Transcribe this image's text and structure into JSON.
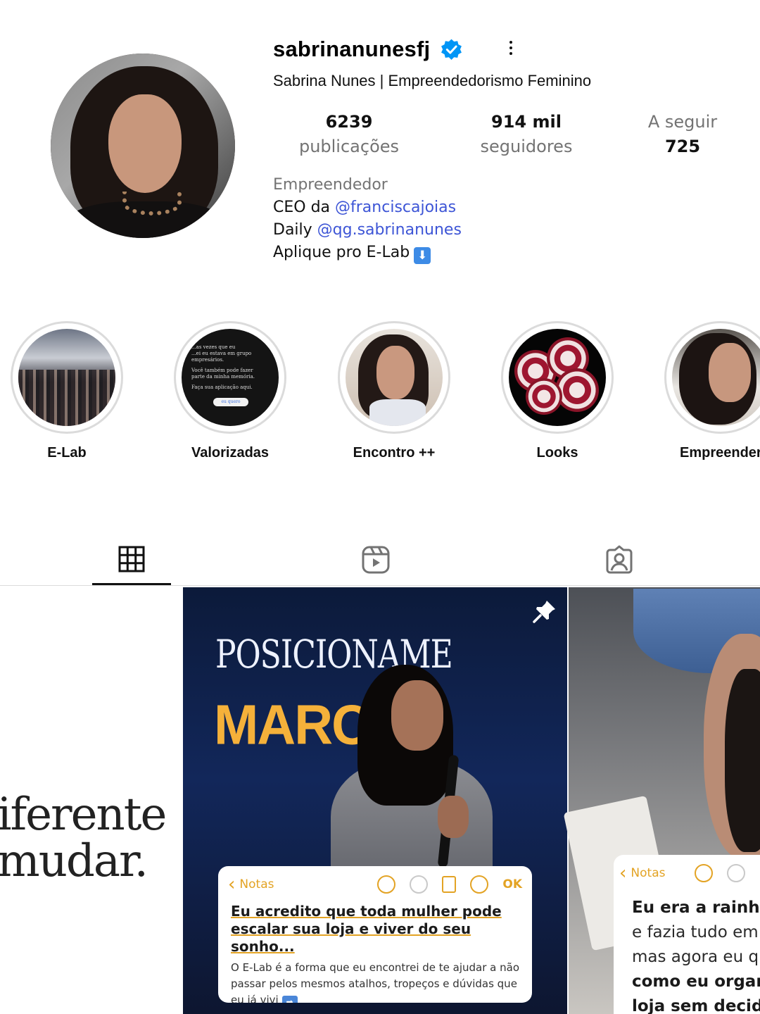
{
  "profile": {
    "username": "sabrinanunesfj",
    "verified": true,
    "full_name": "Sabrina Nunes | Empreendedorismo Feminino",
    "stats": {
      "posts_count": "6239",
      "posts_label": "publicações",
      "followers_count": "914 mil",
      "followers_label": "seguidores",
      "following_label": "A seguir",
      "following_count": "725"
    },
    "bio": {
      "category": "Empreendedor",
      "line1_prefix": "CEO da ",
      "line1_mention": "@franciscajoias",
      "line2_prefix": "Daily ",
      "line2_mention": "@qg.sabrinanunes",
      "line3": "Aplique pro E-Lab"
    }
  },
  "highlights": [
    {
      "label": "E-Lab"
    },
    {
      "label": "Valorizadas",
      "thumb_text": [
        "...as vezes que eu",
        "...ei eu estava em grupo",
        "empresários.",
        "Você também pode fazer",
        "parte da minha memória.",
        "Faça sua aplicação aqui."
      ],
      "thumb_button": "eu quero"
    },
    {
      "label": "Encontro ++"
    },
    {
      "label": "Looks"
    },
    {
      "label": "Empreender"
    }
  ],
  "tabs": [
    {
      "name": "posts",
      "icon": "grid-icon",
      "active": true
    },
    {
      "name": "reels",
      "icon": "reels-icon",
      "active": false
    },
    {
      "name": "tagged",
      "icon": "tagged-icon",
      "active": false
    }
  ],
  "posts": [
    {
      "text_lines": [
        "iferente",
        "mudar."
      ]
    },
    {
      "pinned": true,
      "poster_line1": "POSICIONAME",
      "poster_line2": "MARCA",
      "note": {
        "back_label": "Notas",
        "ok_label": "OK",
        "headline": "Eu acredito que toda mulher pode escalar sua loja e viver do seu sonho...",
        "body": "O E-Lab é a forma que eu encontrei de te ajudar a não passar pelos mesmos atalhos, tropeços e dúvidas que eu já vivi"
      }
    },
    {
      "note": {
        "back_label": "Notas",
        "lines": [
          "Eu era a rainha",
          "e fazia tudo em",
          "mas agora eu q",
          "como eu organ",
          "loja sem decidi"
        ]
      }
    }
  ],
  "colors": {
    "mention": "#3d55d6",
    "verified": "#0095f6",
    "notes_accent": "#e3a324",
    "marca_text": "#f5b13a"
  }
}
